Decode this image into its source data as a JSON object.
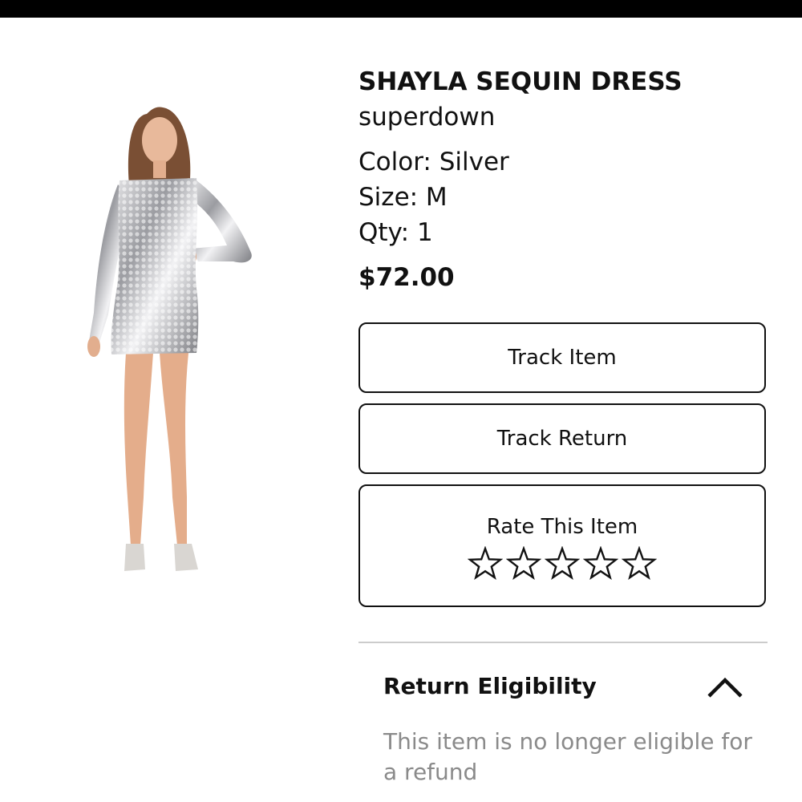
{
  "product": {
    "title": "SHAYLA SEQUIN DRESS",
    "brand": "superdown",
    "color_label": "Color: Silver",
    "size_label": "Size: M",
    "qty_label": "Qty: 1",
    "price": "$72.00"
  },
  "actions": {
    "track_item": "Track Item",
    "track_return": "Track Return",
    "rate_label": "Rate This Item",
    "rating": 0,
    "max_rating": 5
  },
  "return_eligibility": {
    "title": "Return Eligibility",
    "message": "This item is no longer eligible for a refund",
    "expanded": true
  },
  "colors": {
    "top_bar": "#000000",
    "text": "#111111",
    "muted_text": "#8a8a8a",
    "divider": "#cccccc"
  },
  "icons": {
    "star": "star-outline-icon",
    "collapse": "chevron-up-icon"
  }
}
